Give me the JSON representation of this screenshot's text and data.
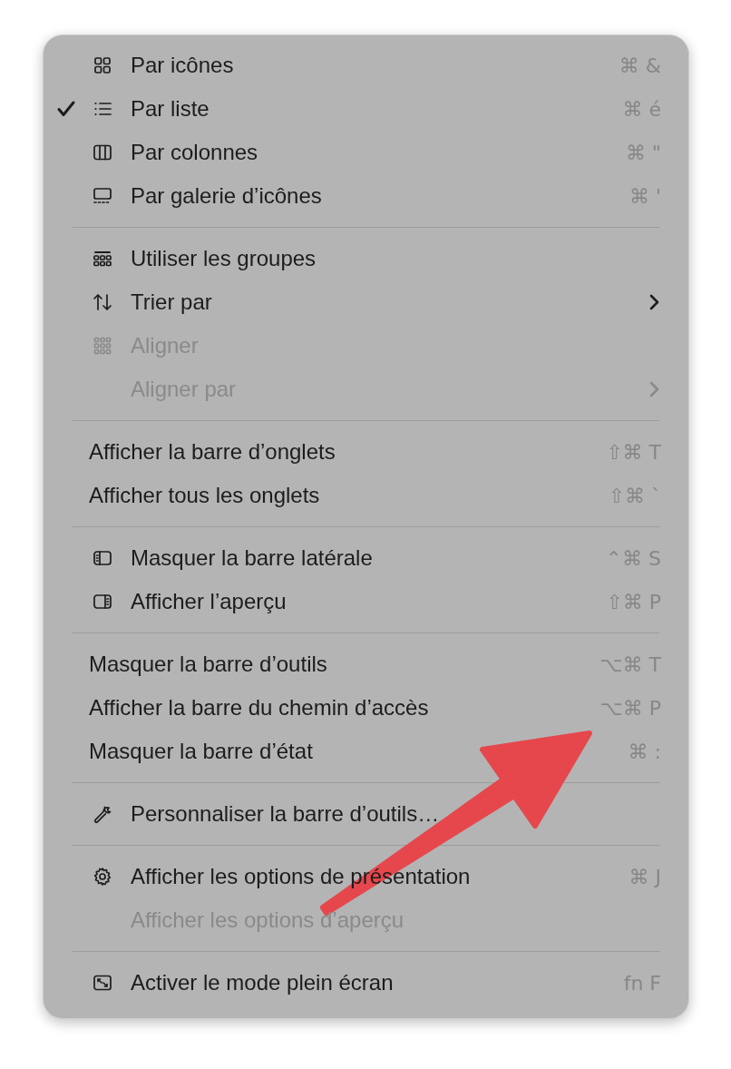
{
  "menu": {
    "groups": [
      {
        "items": [
          {
            "label": "Par icônes",
            "kind": "indented",
            "checked": false,
            "disabled": false,
            "submenu": false,
            "shortcut": "⌘ &"
          },
          {
            "label": "Par liste",
            "kind": "indented",
            "checked": true,
            "disabled": false,
            "submenu": false,
            "shortcut": "⌘ é"
          },
          {
            "label": "Par colonnes",
            "kind": "indented",
            "checked": false,
            "disabled": false,
            "submenu": false,
            "shortcut": "⌘ \""
          },
          {
            "label": "Par galerie d’icônes",
            "kind": "indented",
            "checked": false,
            "disabled": false,
            "submenu": false,
            "shortcut": "⌘ '"
          }
        ]
      },
      {
        "items": [
          {
            "label": "Utiliser les groupes",
            "kind": "indented",
            "checked": false,
            "disabled": false,
            "submenu": false
          },
          {
            "label": "Trier par",
            "kind": "indented",
            "checked": false,
            "disabled": false,
            "submenu": true
          },
          {
            "label": "Aligner",
            "kind": "indented",
            "checked": false,
            "disabled": true,
            "submenu": false
          },
          {
            "label": "Aligner par",
            "kind": "indented",
            "checked": false,
            "disabled": true,
            "submenu": true
          }
        ]
      },
      {
        "items": [
          {
            "label": "Afficher la barre d’onglets",
            "kind": "flush",
            "checked": false,
            "disabled": false,
            "submenu": false,
            "shortcut": "⇧⌘ T"
          },
          {
            "label": "Afficher tous les onglets",
            "kind": "flush",
            "checked": false,
            "disabled": false,
            "submenu": false,
            "shortcut": "⇧⌘ `"
          }
        ]
      },
      {
        "items": [
          {
            "label": "Masquer la barre latérale",
            "kind": "indented",
            "checked": false,
            "disabled": false,
            "submenu": false,
            "shortcut": "⌃⌘ S"
          },
          {
            "label": "Afficher l’aperçu",
            "kind": "indented",
            "checked": false,
            "disabled": false,
            "submenu": false,
            "shortcut": "⇧⌘ P"
          }
        ]
      },
      {
        "items": [
          {
            "label": "Masquer la barre d’outils",
            "kind": "flush",
            "checked": false,
            "disabled": false,
            "submenu": false,
            "shortcut": "⌥⌘ T"
          },
          {
            "label": "Afficher la barre du chemin d’accès",
            "kind": "flush",
            "checked": false,
            "disabled": false,
            "submenu": false,
            "shortcut": "⌥⌘ P"
          },
          {
            "label": "Masquer la barre d’état",
            "kind": "flush",
            "checked": false,
            "disabled": false,
            "submenu": false,
            "shortcut": "⌘ :"
          }
        ]
      },
      {
        "items": [
          {
            "label": "Personnaliser la barre d’outils…",
            "kind": "indented",
            "checked": false,
            "disabled": false,
            "submenu": false
          }
        ]
      },
      {
        "items": [
          {
            "label": "Afficher les options de présentation",
            "kind": "indented",
            "checked": false,
            "disabled": false,
            "submenu": false,
            "shortcut": "⌘ J"
          },
          {
            "label": "Afficher les options d’aperçu",
            "kind": "indented",
            "checked": false,
            "disabled": true,
            "submenu": false
          }
        ]
      },
      {
        "items": [
          {
            "label": "Activer le mode plein écran",
            "kind": "indented",
            "checked": false,
            "disabled": false,
            "submenu": false,
            "shortcut": "fn F"
          }
        ]
      }
    ]
  }
}
